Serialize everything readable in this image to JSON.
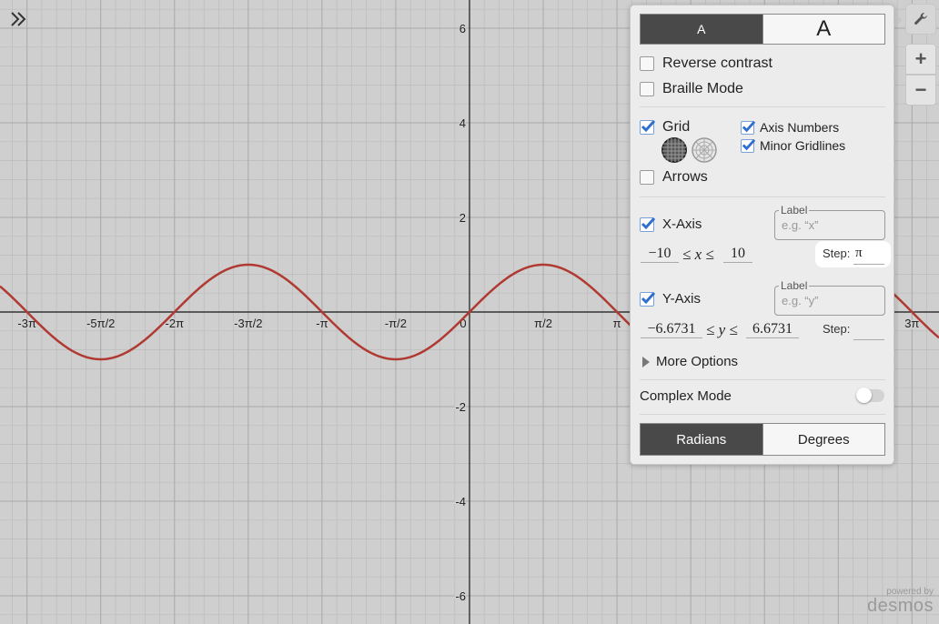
{
  "graph": {
    "x_tick_labels": [
      "-3π",
      "-5π/2",
      "-2π",
      "-3π/2",
      "-π",
      "-π/2",
      "0",
      "π/2",
      "π",
      "3π"
    ],
    "y_tick_labels": [
      "6",
      "4",
      "2",
      "-2",
      "-4",
      "-6"
    ],
    "curve": {
      "equation": "y = sin(x)",
      "color": "#b03a32",
      "amplitude": 1
    },
    "x_range": [
      -10,
      10
    ],
    "y_range": [
      -6.6731,
      6.6731
    ],
    "x_step": "π",
    "grid": true,
    "minor_gridlines": true,
    "colors": {
      "background": "#cfcfcf",
      "major_grid": "#a8a8a8",
      "minor_grid": "#bcbcbc",
      "axis": "#333333"
    }
  },
  "toolbar": {
    "expand_icon": "double-chevron-right-icon",
    "wrench_icon": "wrench-icon",
    "zoom_in_label": "+",
    "zoom_out_label": "−"
  },
  "settings": {
    "font_size": {
      "small": "A",
      "large": "A",
      "selected": "small"
    },
    "reverse_contrast": {
      "label": "Reverse contrast",
      "checked": false
    },
    "braille_mode": {
      "label": "Braille Mode",
      "checked": false
    },
    "grid": {
      "label": "Grid",
      "checked": true,
      "types": [
        "cartesian",
        "polar"
      ],
      "selected_type": "cartesian"
    },
    "axis_numbers": {
      "label": "Axis Numbers",
      "checked": true
    },
    "minor_gridlines": {
      "label": "Minor Gridlines",
      "checked": true
    },
    "arrows": {
      "label": "Arrows",
      "checked": false
    },
    "x_axis": {
      "label": "X-Axis",
      "checked": true,
      "label_field": {
        "legend": "Label",
        "placeholder": "e.g. “x”"
      },
      "min": "−10",
      "max": "10",
      "var": "x",
      "step_label": "Step:",
      "step": "π"
    },
    "y_axis": {
      "label": "Y-Axis",
      "checked": true,
      "label_field": {
        "legend": "Label",
        "placeholder": "e.g. “y”"
      },
      "min": "−6.6731",
      "max": "6.6731",
      "var": "y",
      "step_label": "Step:",
      "step": ""
    },
    "more_options": "More Options",
    "complex_mode": {
      "label": "Complex Mode",
      "on": false
    },
    "angle_mode": {
      "radians": "Radians",
      "degrees": "Degrees",
      "selected": "radians"
    }
  },
  "branding": {
    "powered_by": "powered by",
    "name": "desmos"
  }
}
